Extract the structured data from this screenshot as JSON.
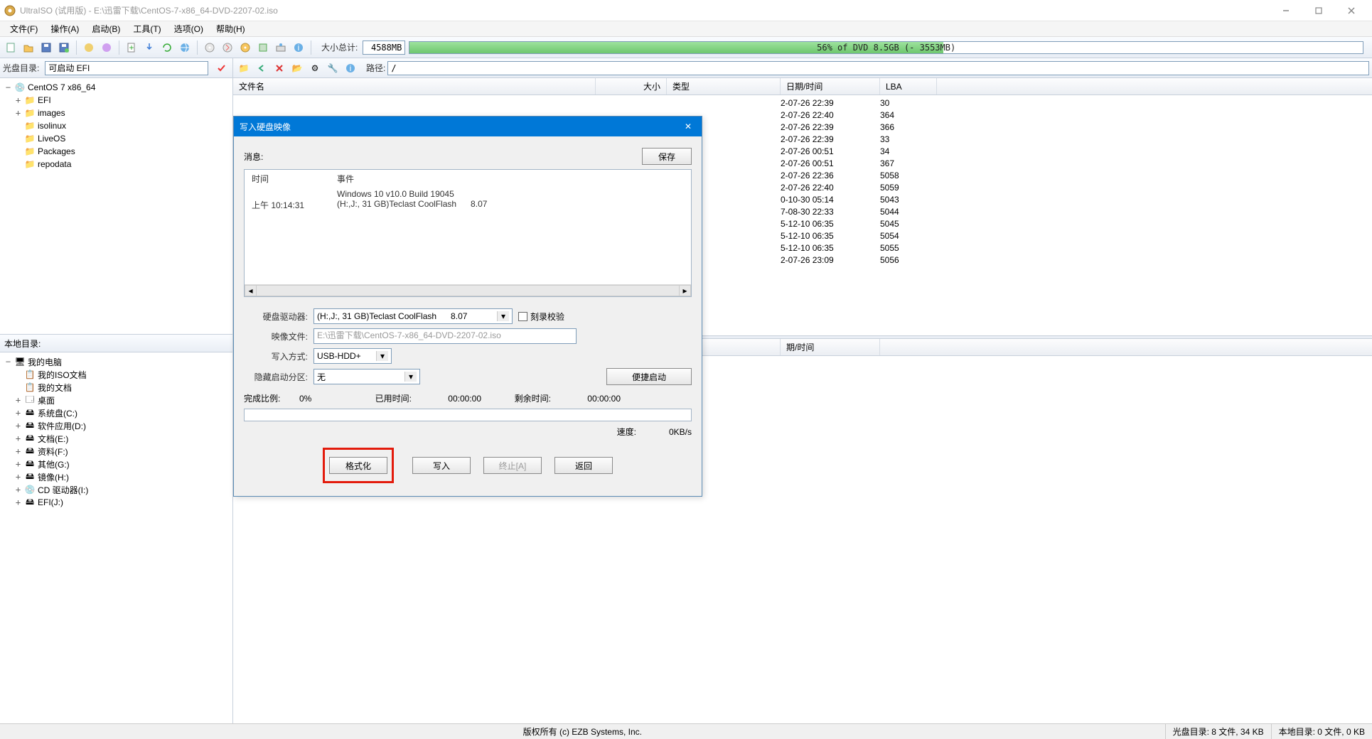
{
  "window": {
    "title": "UltraISO (试用版) - E:\\迅雷下载\\CentOS-7-x86_64-DVD-2207-02.iso"
  },
  "menu": {
    "file": "文件(F)",
    "action": "操作(A)",
    "boot": "启动(B)",
    "tools": "工具(T)",
    "options": "选项(O)",
    "help": "帮助(H)"
  },
  "toolbar": {
    "size_label": "大小总计:",
    "size_value": "4588MB",
    "capacity_text": "56% of DVD 8.5GB (- 3553MB)",
    "capacity_pct": 56
  },
  "leftbar": {
    "label": "光盘目录:",
    "combo": "可启动 EFI"
  },
  "rightbar": {
    "path_label": "路径:",
    "path_value": "/"
  },
  "iso_tree": {
    "root": "CentOS 7 x86_64",
    "children": [
      "EFI",
      "images",
      "isolinux",
      "LiveOS",
      "Packages",
      "repodata"
    ]
  },
  "file_headers": {
    "name": "文件名",
    "size": "大小",
    "type": "类型",
    "date": "日期/时间",
    "lba": "LBA"
  },
  "file_rows": [
    {
      "date": "2-07-26 22:39",
      "lba": "30"
    },
    {
      "date": "2-07-26 22:40",
      "lba": "364"
    },
    {
      "date": "2-07-26 22:39",
      "lba": "366"
    },
    {
      "date": "2-07-26 22:39",
      "lba": "33"
    },
    {
      "date": "2-07-26 00:51",
      "lba": "34"
    },
    {
      "date": "2-07-26 00:51",
      "lba": "367"
    },
    {
      "date": "2-07-26 22:36",
      "lba": "5058"
    },
    {
      "date": "2-07-26 22:40",
      "lba": "5059"
    },
    {
      "date": "0-10-30 05:14",
      "lba": "5043"
    },
    {
      "date": "7-08-30 22:33",
      "lba": "5044"
    },
    {
      "date": "5-12-10 06:35",
      "lba": "5045"
    },
    {
      "date": "5-12-10 06:35",
      "lba": "5054"
    },
    {
      "date": "5-12-10 06:35",
      "lba": "5055"
    },
    {
      "date": "2-07-26 23:09",
      "lba": "5056"
    }
  ],
  "local": {
    "header": "本地目录:",
    "root": "我的电脑",
    "items": [
      {
        "icon": "doc-icon",
        "label": "我的ISO文档"
      },
      {
        "icon": "doc-icon",
        "label": "我的文档"
      },
      {
        "icon": "desk-icon",
        "label": "桌面"
      },
      {
        "icon": "drive-icon",
        "label": "系统盘(C:)"
      },
      {
        "icon": "drive-icon",
        "label": "软件应用(D:)"
      },
      {
        "icon": "drive-icon",
        "label": "文档(E:)"
      },
      {
        "icon": "drive-icon",
        "label": "资料(F:)"
      },
      {
        "icon": "drive-icon",
        "label": "其他(G:)"
      },
      {
        "icon": "drive-icon",
        "label": "镜像(H:)"
      },
      {
        "icon": "cd-icon",
        "label": "CD 驱动器(I:)"
      },
      {
        "icon": "drive-icon",
        "label": "EFI(J:)"
      }
    ]
  },
  "lower_headers": {
    "date": "期/时间"
  },
  "status": {
    "copyright": "版权所有 (c) EZB Systems, Inc.",
    "left": "光盘目录: 8 文件, 34 KB",
    "right": "本地目录: 0 文件, 0 KB"
  },
  "dialog": {
    "title": "写入硬盘映像",
    "msg_label": "消息:",
    "save_btn": "保存",
    "msg_hdr_time": "时间",
    "msg_hdr_event": "事件",
    "msg_rows": [
      {
        "t": "",
        "e": "Windows 10 v10.0 Build 19045"
      },
      {
        "t": "上午 10:14:31",
        "e": "(H:,J:, 31 GB)Teclast CoolFlash      8.07"
      }
    ],
    "drive_label": "硬盘驱动器:",
    "drive_value": "(H:,J:, 31 GB)Teclast CoolFlash      8.07",
    "verify": "刻录校验",
    "image_label": "映像文件:",
    "image_value": "E:\\迅雷下载\\CentOS-7-x86_64-DVD-2207-02.iso",
    "method_label": "写入方式:",
    "method_value": "USB-HDD+",
    "hidden_label": "隐藏启动分区:",
    "hidden_value": "无",
    "quick_boot": "便捷启动",
    "done_label": "完成比例:",
    "done_value": "0%",
    "elapsed_label": "已用时间:",
    "elapsed_value": "00:00:00",
    "remain_label": "剩余时间:",
    "remain_value": "00:00:00",
    "speed_label": "速度:",
    "speed_value": "0KB/s",
    "btn_format": "格式化",
    "btn_write": "写入",
    "btn_abort": "终止[A]",
    "btn_back": "返回"
  }
}
